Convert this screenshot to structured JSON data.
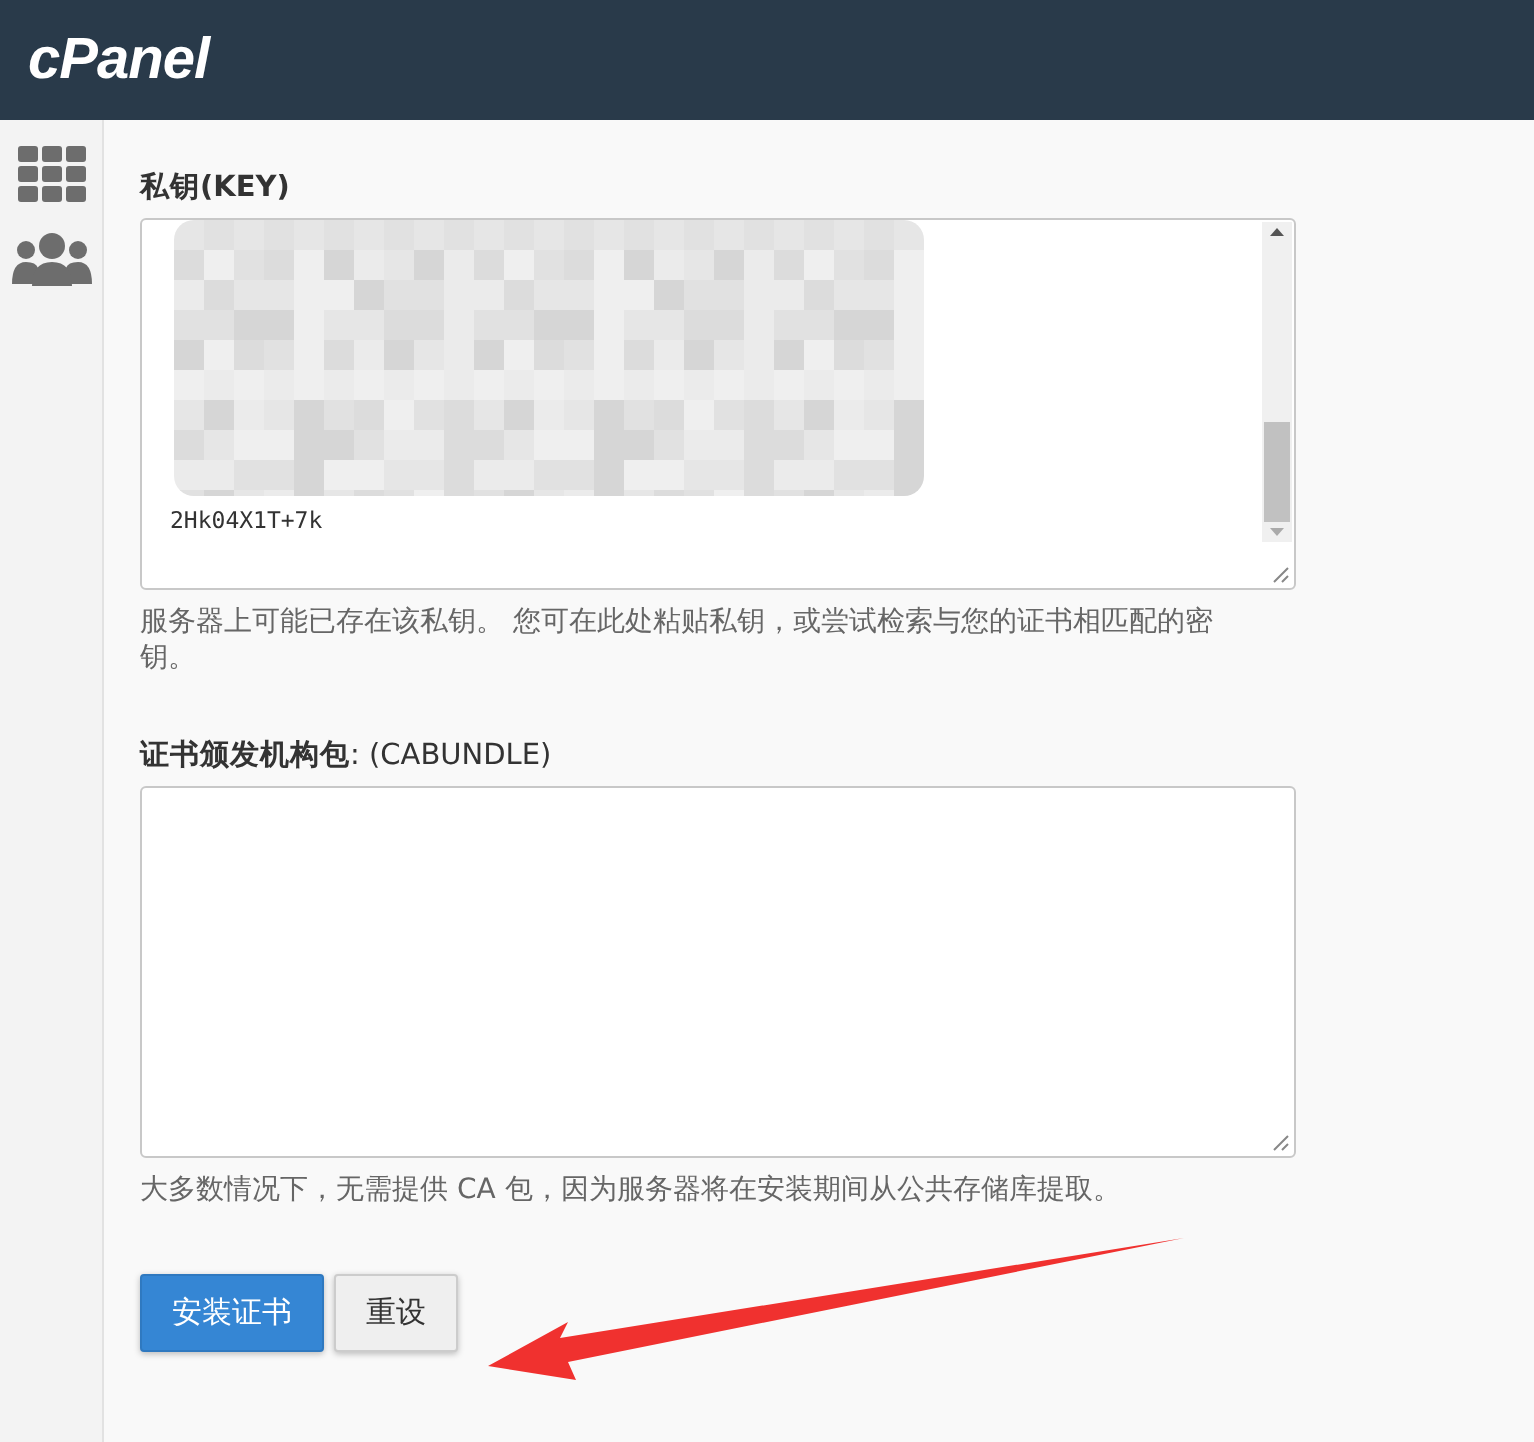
{
  "header": {
    "logo": "cPanel"
  },
  "sidebar": {
    "items": [
      {
        "kind": "grid"
      },
      {
        "kind": "users"
      }
    ]
  },
  "key_section": {
    "label": "私钥(KEY)",
    "visible_text": "2Hk04X1T+7k",
    "help": "服务器上可能已存在该私钥。 您可在此处粘贴私钥，或尝试检索与您的证书相匹配的密钥。"
  },
  "cabundle_section": {
    "label_bold": "证书颁发机构包",
    "label_rest": ": (CABUNDLE)",
    "help": "大多数情况下，无需提供 CA 包，因为服务器将在安装期间从公共存储库提取。"
  },
  "buttons": [
    {
      "label": "安装证书",
      "kind": "primary"
    },
    {
      "label": "重设",
      "kind": "default"
    }
  ]
}
